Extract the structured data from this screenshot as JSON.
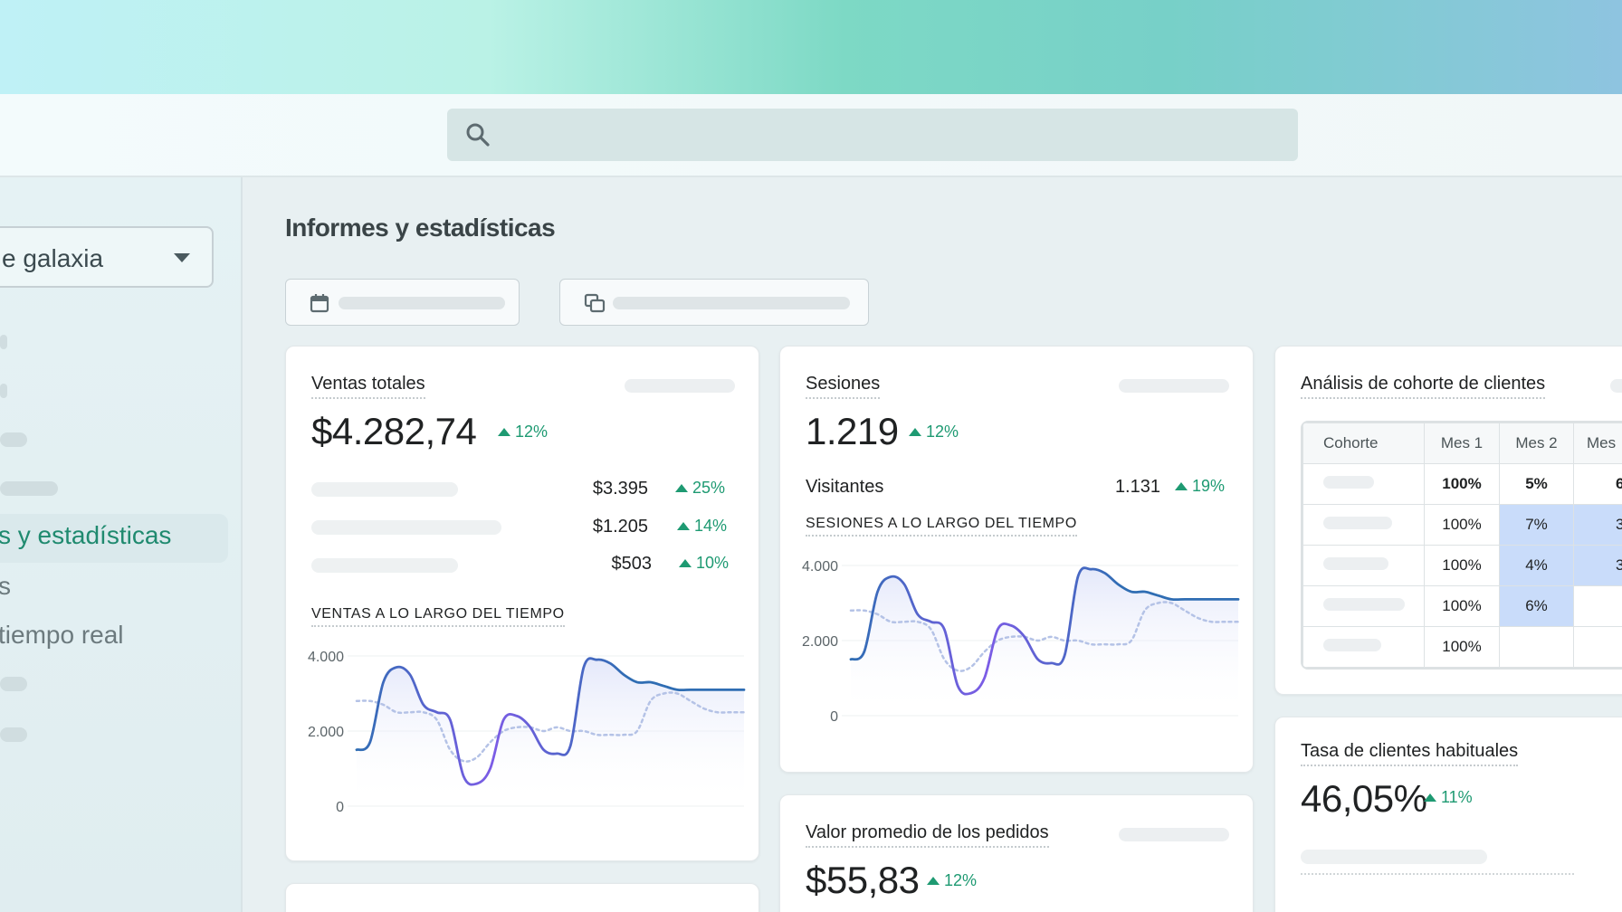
{
  "search": {
    "placeholder": ""
  },
  "sidebar": {
    "store_label": "e galaxia",
    "items": [
      {
        "label": "s y estadísticas",
        "active": true
      },
      {
        "label": "s"
      },
      {
        "label": "tiempo real"
      }
    ]
  },
  "page": {
    "title": "Informes y estadísticas"
  },
  "colors": {
    "accent": "#1e9a72",
    "line": "#2f6db3",
    "line_alt": "#7c5ce6",
    "highlight": "#c9dcfa"
  },
  "cards": {
    "sales": {
      "title": "Ventas totales",
      "value": "$4.282,74",
      "delta": "12%",
      "rows": [
        {
          "value": "$3.395",
          "delta": "25%"
        },
        {
          "value": "$1.205",
          "delta": "14%"
        },
        {
          "value": "$503",
          "delta": "10%"
        }
      ],
      "chart_title": "VENTAS A LO LARGO DEL TIEMPO"
    },
    "sessions": {
      "title": "Sesiones",
      "value": "1.219",
      "delta": "12%",
      "visitors_label": "Visitantes",
      "visitors_value": "1.131",
      "visitors_delta": "19%",
      "chart_title": "SESIONES A LO LARGO DEL TIEMPO"
    },
    "aov": {
      "title": "Valor promedio de los pedidos",
      "value": "$55,83",
      "delta": "12%"
    },
    "cohort": {
      "title": "Análisis de cohorte de clientes",
      "headers": [
        "Cohorte",
        "Mes 1",
        "Mes 2",
        "Mes"
      ],
      "rows": [
        [
          "",
          "100%",
          "5%",
          "6"
        ],
        [
          "",
          "100%",
          "7%",
          "3"
        ],
        [
          "",
          "100%",
          "4%",
          "3"
        ],
        [
          "",
          "100%",
          "6%",
          ""
        ],
        [
          "",
          "100%",
          "",
          ""
        ]
      ]
    },
    "returning": {
      "title": "Tasa de clientes habituales",
      "value": "46,05%",
      "delta": "11%"
    }
  },
  "chart_data": [
    {
      "type": "line",
      "title": "VENTAS A LO LARGO DEL TIEMPO",
      "ytick_labels": [
        "4.000",
        "2.000",
        "0"
      ],
      "ylim": [
        0,
        4000
      ],
      "x": [
        0,
        1,
        2,
        3,
        4,
        5,
        6,
        7,
        8,
        9,
        10,
        11,
        12,
        13,
        14,
        15,
        16,
        17,
        18,
        19,
        20,
        21,
        22,
        23,
        24,
        25,
        26,
        27,
        28,
        29
      ],
      "series": [
        {
          "values": [
            1500,
            1700,
            3300,
            3700,
            3500,
            2700,
            2500,
            2300,
            800,
            600,
            1000,
            2300,
            2400,
            2100,
            1500,
            1400,
            1600,
            3700,
            3900,
            3800,
            3500,
            3300,
            3300,
            3200,
            3100,
            3100,
            3100,
            3100,
            3100,
            3100
          ]
        },
        {
          "values": [
            2800,
            2800,
            2700,
            2500,
            2500,
            2500,
            2300,
            1500,
            1200,
            1300,
            1700,
            2000,
            2100,
            2100,
            2000,
            2100,
            2000,
            2000,
            1900,
            1900,
            1900,
            2000,
            2800,
            3000,
            3000,
            2800,
            2600,
            2500,
            2500,
            2500
          ]
        }
      ],
      "grid": true
    },
    {
      "type": "line",
      "title": "SESIONES A LO LARGO DEL TIEMPO",
      "ytick_labels": [
        "4.000",
        "2.000",
        "0"
      ],
      "ylim": [
        0,
        4000
      ],
      "x": [
        0,
        1,
        2,
        3,
        4,
        5,
        6,
        7,
        8,
        9,
        10,
        11,
        12,
        13,
        14,
        15,
        16,
        17,
        18,
        19,
        20,
        21,
        22,
        23,
        24,
        25,
        26,
        27,
        28,
        29
      ],
      "series": [
        {
          "values": [
            1500,
            1700,
            3300,
            3700,
            3500,
            2700,
            2500,
            2300,
            800,
            600,
            1000,
            2300,
            2400,
            2100,
            1500,
            1400,
            1600,
            3700,
            3900,
            3800,
            3500,
            3300,
            3300,
            3200,
            3100,
            3100,
            3100,
            3100,
            3100,
            3100
          ]
        },
        {
          "values": [
            2800,
            2800,
            2700,
            2500,
            2500,
            2500,
            2300,
            1500,
            1200,
            1300,
            1700,
            2000,
            2100,
            2100,
            2000,
            2100,
            2000,
            2000,
            1900,
            1900,
            1900,
            2000,
            2800,
            3000,
            3000,
            2800,
            2600,
            2500,
            2500,
            2500
          ]
        }
      ],
      "grid": true
    }
  ]
}
